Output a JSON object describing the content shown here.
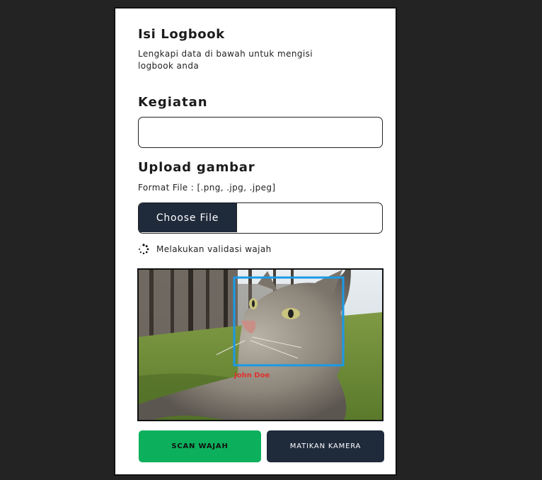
{
  "header": {
    "title": "Isi Logbook",
    "subtitle": "Lengkapi data di bawah untuk mengisi logbook anda"
  },
  "kegiatan": {
    "label": "Kegiatan",
    "value": ""
  },
  "upload": {
    "label": "Upload gambar",
    "format_hint": "Format File : [.png, .jpg, .jpeg]",
    "choose_label": "Choose File"
  },
  "status": {
    "text": "Melakukan validasi wajah",
    "icon": "spinner-icon"
  },
  "camera": {
    "detection_label": "John Doe",
    "box_color": "#1a9ae6",
    "label_color": "#e0312f"
  },
  "actions": {
    "scan_label": "SCAN WAJAH",
    "stop_label": "MATIKAN KAMERA"
  },
  "colors": {
    "primary_dark": "#1f2a3b",
    "success": "#0cb05c"
  }
}
